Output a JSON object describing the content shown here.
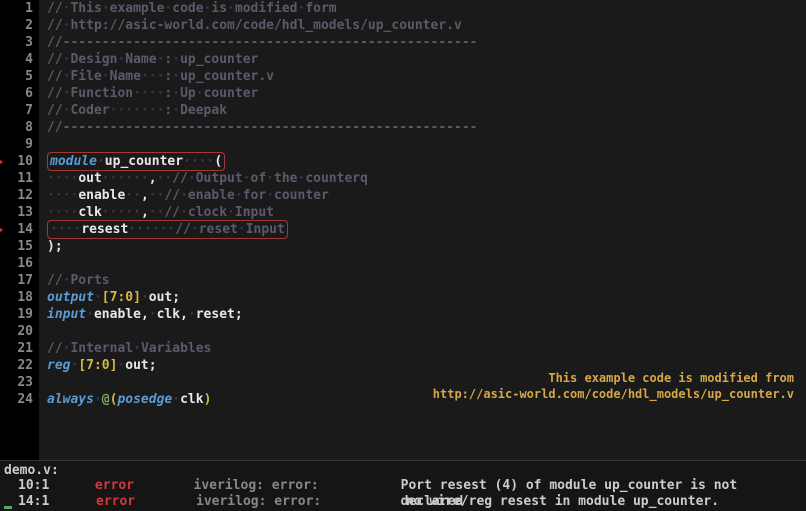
{
  "lines": [
    {
      "n": "1",
      "err": false,
      "html": "<span class='cm'>//</span><span class='ws'>·</span><span class='cm'>This</span><span class='ws'>·</span><span class='cm'>example</span><span class='ws'>·</span><span class='cm'>code</span><span class='ws'>·</span><span class='cm'>is</span><span class='ws'>·</span><span class='cm'>modified</span><span class='ws'>·</span><span class='cm'>form</span>"
    },
    {
      "n": "2",
      "err": false,
      "html": "<span class='cm'>//</span><span class='ws'>·</span><span class='cm'>http://asic-world.com/code/hdl_models/up_counter.v</span>"
    },
    {
      "n": "3",
      "err": false,
      "html": "<span class='cm'>//-----------------------------------------------------</span>"
    },
    {
      "n": "4",
      "err": false,
      "html": "<span class='cm'>//</span><span class='ws'>·</span><span class='cm'>Design</span><span class='ws'>·</span><span class='cm'>Name</span><span class='ws'>·</span><span class='cm'>:</span><span class='ws'>·</span><span class='cm'>up_counter</span>"
    },
    {
      "n": "5",
      "err": false,
      "html": "<span class='cm'>//</span><span class='ws'>·</span><span class='cm'>File</span><span class='ws'>·</span><span class='cm'>Name</span><span class='ws'>···</span><span class='cm'>:</span><span class='ws'>·</span><span class='cm'>up_counter.v</span>"
    },
    {
      "n": "6",
      "err": false,
      "html": "<span class='cm'>//</span><span class='ws'>·</span><span class='cm'>Function</span><span class='ws'>····</span><span class='cm'>:</span><span class='ws'>·</span><span class='cm'>Up</span><span class='ws'>·</span><span class='cm'>counter</span>"
    },
    {
      "n": "7",
      "err": false,
      "html": "<span class='cm'>//</span><span class='ws'>·</span><span class='cm'>Coder</span><span class='ws'>·······</span><span class='cm'>:</span><span class='ws'>·</span><span class='cm'>Deepak</span>"
    },
    {
      "n": "8",
      "err": false,
      "html": "<span class='cm'>//-----------------------------------------------------</span>"
    },
    {
      "n": "9",
      "err": false,
      "html": ""
    },
    {
      "n": "10",
      "err": true,
      "html": "<span class='errbox'><span class='kw'>module</span><span class='ws'>·</span><span class='fn'>up_counter</span><span class='ws'>····</span><span class='pn'>(</span></span>"
    },
    {
      "n": "11",
      "err": false,
      "html": "<span class='ws'>····</span><span class='wh'>out</span><span class='ws'>······</span><span class='pn'>,</span><span class='ws'>··</span><span class='cm'>//</span><span class='ws'>·</span><span class='cm'>Output</span><span class='ws'>·</span><span class='cm'>of</span><span class='ws'>·</span><span class='cm'>the</span><span class='ws'>·</span><span class='cm'>counterq</span>"
    },
    {
      "n": "12",
      "err": false,
      "html": "<span class='ws'>····</span><span class='wh'>enable</span><span class='ws'>··</span><span class='pn'>,</span><span class='ws'>··</span><span class='cm'>//</span><span class='ws'>·</span><span class='cm'>enable</span><span class='ws'>·</span><span class='cm'>for</span><span class='ws'>·</span><span class='cm'>counter</span>"
    },
    {
      "n": "13",
      "err": false,
      "html": "<span class='ws'>····</span><span class='wh'>clk</span><span class='ws'>·····</span><span class='pn'>,</span><span class='ws'>··</span><span class='cm'>//</span><span class='ws'>·</span><span class='cm'>clock</span><span class='ws'>·</span><span class='cm'>Input</span>"
    },
    {
      "n": "14",
      "err": true,
      "html": "<span class='errbox'><span class='ws'>····</span><span class='wh'>resest</span><span class='ws'>······</span><span class='cm'>//</span><span class='ws'>·</span><span class='cm'>reset</span><span class='ws'>·</span><span class='cm'>Input</span></span>"
    },
    {
      "n": "15",
      "err": false,
      "html": "<span class='pn'>);</span>"
    },
    {
      "n": "16",
      "err": false,
      "html": ""
    },
    {
      "n": "17",
      "err": false,
      "html": "<span class='cm'>//</span><span class='ws'>·</span><span class='cm'>Ports</span>"
    },
    {
      "n": "18",
      "err": false,
      "html": "<span class='kw'>output</span><span class='ws'>·</span><span class='ye'>[</span><span class='or'>7</span><span class='ye'>:</span><span class='or'>0</span><span class='ye'>]</span><span class='ws'>·</span><span class='wh'>out</span><span class='pn'>;</span>"
    },
    {
      "n": "19",
      "err": false,
      "html": "<span class='kw'>input</span><span class='ws'>·</span><span class='wh'>enable</span><span class='pn'>,</span><span class='ws'>·</span><span class='wh'>clk</span><span class='pn'>,</span><span class='ws'>·</span><span class='wh'>reset</span><span class='pn'>;</span>"
    },
    {
      "n": "20",
      "err": false,
      "html": ""
    },
    {
      "n": "21",
      "err": false,
      "html": "<span class='cm'>//</span><span class='ws'>·</span><span class='cm'>Internal</span><span class='ws'>·</span><span class='cm'>Variables</span>"
    },
    {
      "n": "22",
      "err": false,
      "html": "<span class='kw'>reg</span><span class='ws'>·</span><span class='ye'>[</span><span class='or'>7</span><span class='ye'>:</span><span class='or'>0</span><span class='ye'>]</span><span class='ws'>·</span><span class='wh'>out</span><span class='pn'>;</span>"
    },
    {
      "n": "23",
      "err": false,
      "html": ""
    },
    {
      "n": "24",
      "err": false,
      "html": "<span class='kw'>always</span><span class='ws'>·</span><span class='gr'>@</span><span class='ye'>(</span><span class='kw'>posedge</span><span class='ws'>·</span><span class='wh'>clk</span><span class='ye'>)</span>"
    }
  ],
  "credit": {
    "line1": "This example code is modified from",
    "line2": "http://asic-world.com/code/hdl_models/up_counter.v"
  },
  "panel": {
    "header": "demo.v:",
    "rows": [
      {
        "loc": "10:1",
        "type": "error",
        "source": "iverilog: error:",
        "msg": "Port resest (4) of module up_counter is not declared"
      },
      {
        "loc": "14:1",
        "type": "error",
        "source": "iverilog: error:",
        "msg": "no wire/reg resest in module up_counter."
      }
    ]
  }
}
